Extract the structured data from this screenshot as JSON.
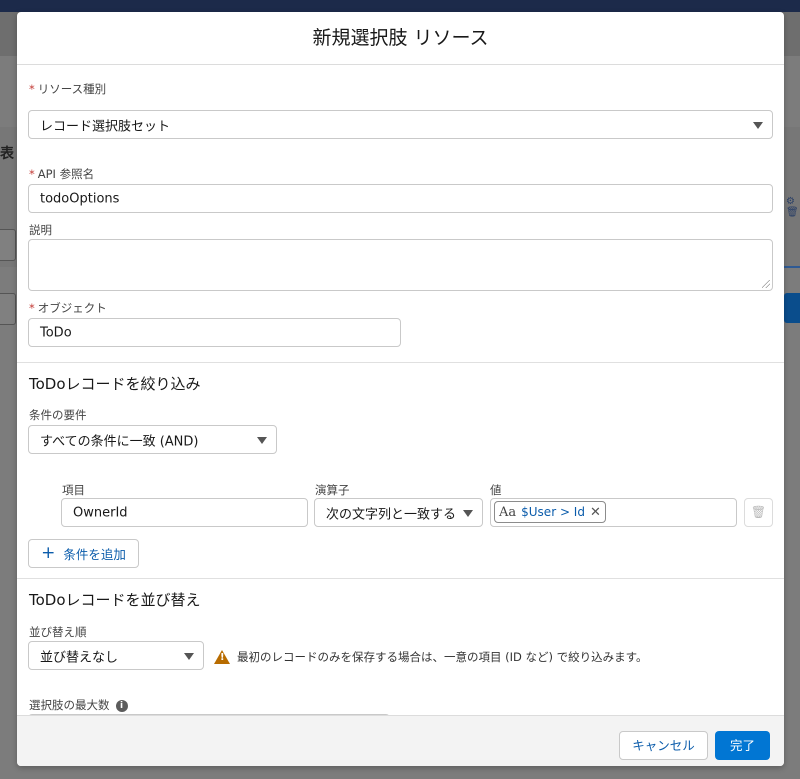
{
  "modal": {
    "title": "新規選択肢 リソース"
  },
  "resource_type": {
    "label": "リソース種別",
    "value": "レコード選択肢セット"
  },
  "api_name": {
    "label": "API 参照名",
    "value": "todoOptions"
  },
  "description": {
    "label": "説明",
    "value": ""
  },
  "object": {
    "label": "オブジェクト",
    "value": "ToDo"
  },
  "filter": {
    "title": "ToDoレコードを絞り込み",
    "requirement_label": "条件の要件",
    "requirement_value": "すべての条件に一致 (AND)",
    "columns": {
      "field": "項目",
      "operator": "演算子",
      "value": "値"
    },
    "rows": [
      {
        "field": "OwnerId",
        "operator": "次の文字列と一致する",
        "value": "$User > Id"
      }
    ],
    "add_condition": "条件を追加"
  },
  "sort": {
    "title": "ToDoレコードを並び替え",
    "order_label": "並び替え順",
    "order_value": "並び替えなし",
    "warning": "最初のレコードのみを保存する場合は、一意の項目 (ID など) で絞り込みます。"
  },
  "max_choices": {
    "label": "選択肢の最大数",
    "value": ""
  },
  "footer": {
    "cancel": "キャンセル",
    "done": "完了"
  },
  "background": {
    "cut_off_heading": "表"
  },
  "colors": {
    "brand": "#0176d3",
    "link": "#0b5cab",
    "required": "#c23934",
    "warning": "#b86c00"
  }
}
